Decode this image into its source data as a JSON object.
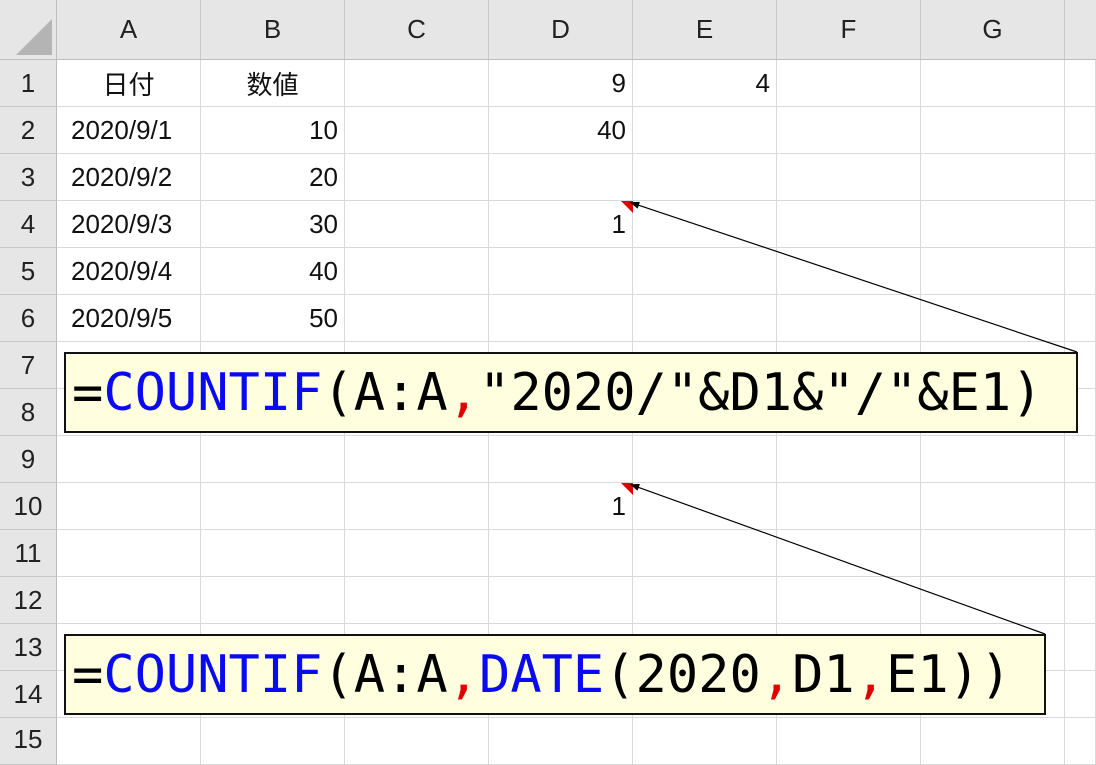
{
  "columns": [
    "A",
    "B",
    "C",
    "D",
    "E",
    "F",
    "G"
  ],
  "rows": [
    "1",
    "2",
    "3",
    "4",
    "5",
    "6",
    "7",
    "8",
    "9",
    "10",
    "11",
    "12",
    "13",
    "14",
    "15"
  ],
  "cells": {
    "A1": "日付",
    "B1": "数値",
    "D1": "9",
    "E1": "4",
    "A2": "2020/9/1",
    "B2": "10",
    "D2": "40",
    "A3": "2020/9/2",
    "B3": "20",
    "A4": "2020/9/3",
    "B4": "30",
    "D4": "1",
    "A5": "2020/9/4",
    "B5": "40",
    "A6": "2020/9/5",
    "B6": "50",
    "D10": "1"
  },
  "callouts": [
    {
      "parts": [
        {
          "text": "=",
          "style": "blk"
        },
        {
          "text": "COUNTIF",
          "style": "fn"
        },
        {
          "text": "(A:A",
          "style": "blk"
        },
        {
          "text": ",",
          "style": "sep"
        },
        {
          "text": "\"2020/\"&D1&\"/\"&E1)",
          "style": "blk"
        }
      ]
    },
    {
      "parts": [
        {
          "text": "=",
          "style": "blk"
        },
        {
          "text": "COUNTIF",
          "style": "fn"
        },
        {
          "text": "(A:A",
          "style": "blk"
        },
        {
          "text": ",",
          "style": "sep"
        },
        {
          "text": "DATE",
          "style": "fn"
        },
        {
          "text": "(2020",
          "style": "blk"
        },
        {
          "text": ",",
          "style": "sep"
        },
        {
          "text": "D1",
          "style": "blk"
        },
        {
          "text": ",",
          "style": "sep"
        },
        {
          "text": "E1))",
          "style": "blk"
        }
      ]
    }
  ],
  "colors": {
    "function": "#0a0aee",
    "separator": "#e00000",
    "callout_bg": "#ffffe0",
    "comment_marker": "#e00000"
  }
}
